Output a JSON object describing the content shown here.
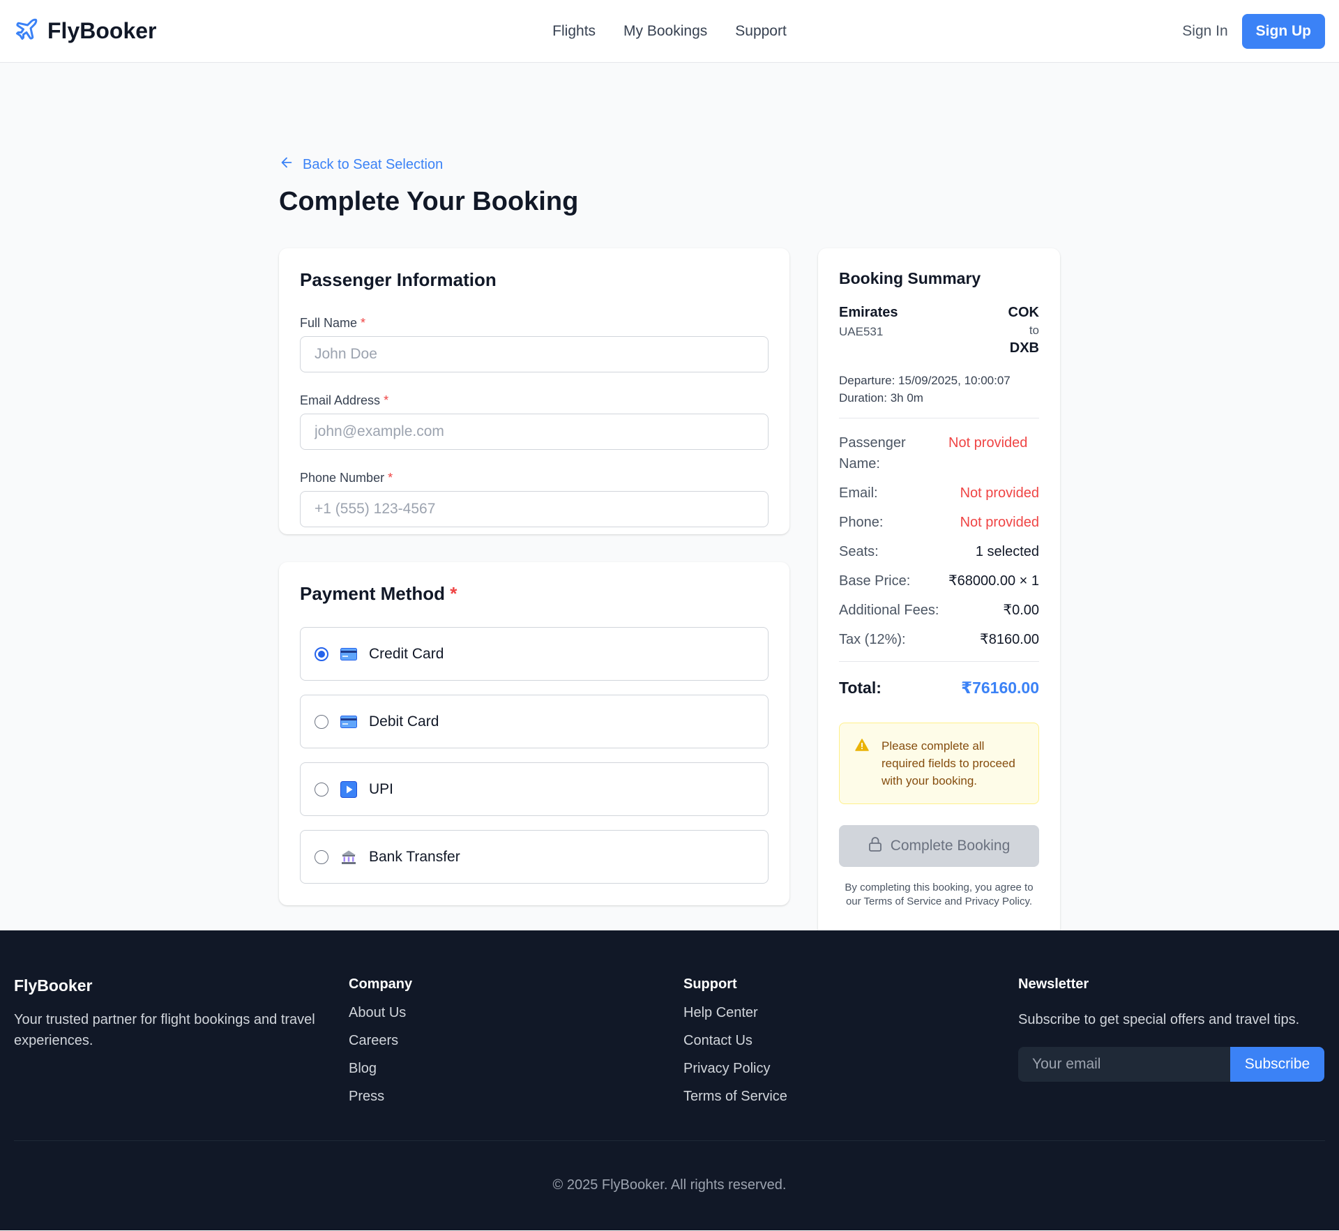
{
  "header": {
    "brand": "FlyBooker",
    "nav": [
      "Flights",
      "My Bookings",
      "Support"
    ],
    "sign_in": "Sign In",
    "sign_up": "Sign Up"
  },
  "page": {
    "back_link": "Back to Seat Selection",
    "title": "Complete Your Booking"
  },
  "passenger": {
    "title": "Passenger Information",
    "fields": [
      {
        "label": "Full Name",
        "required": "*",
        "placeholder": "John Doe",
        "value": ""
      },
      {
        "label": "Email Address",
        "required": "*",
        "placeholder": "john@example.com",
        "value": ""
      },
      {
        "label": "Phone Number",
        "required": "*",
        "placeholder": "+1 (555) 123-4567",
        "value": ""
      }
    ]
  },
  "payment": {
    "title": "Payment Method",
    "required": "*",
    "options": [
      {
        "label": "Credit Card",
        "icon": "credit-card-icon",
        "selected": true
      },
      {
        "label": "Debit Card",
        "icon": "credit-card-icon",
        "selected": false
      },
      {
        "label": "UPI",
        "icon": "play-icon",
        "selected": false
      },
      {
        "label": "Bank Transfer",
        "icon": "bank-icon",
        "selected": false
      }
    ]
  },
  "summary": {
    "title": "Booking Summary",
    "airline": "Emirates",
    "flight_no": "UAE531",
    "from": "COK",
    "to_word": "to",
    "to": "DXB",
    "departure": "Departure: 15/09/2025, 10:00:07",
    "duration": "Duration: 3h 0m",
    "rows": [
      {
        "key": "Passenger Name:",
        "value": "Not provided",
        "missing": true
      },
      {
        "key": "Email:",
        "value": "Not provided",
        "missing": true
      },
      {
        "key": "Phone:",
        "value": "Not provided",
        "missing": true
      },
      {
        "key": "Seats:",
        "value": "1 selected",
        "missing": false
      },
      {
        "key": "Base Price:",
        "value": "₹68000.00 × 1",
        "missing": false
      },
      {
        "key": "Additional Fees:",
        "value": "₹0.00",
        "missing": false
      },
      {
        "key": "Tax (12%):",
        "value": "₹8160.00",
        "missing": false
      }
    ],
    "total_label": "Total:",
    "total_value": "₹76160.00",
    "warning": "Please complete all required fields to proceed with your booking.",
    "cta": "Complete Booking",
    "terms": "By completing this booking, you agree to our Terms of Service and Privacy Policy."
  },
  "footer": {
    "brand": "FlyBooker",
    "tagline": "Your trusted partner for flight bookings and travel experiences.",
    "company_title": "Company",
    "company_links": [
      "About Us",
      "Careers",
      "Blog",
      "Press"
    ],
    "support_title": "Support",
    "support_links": [
      "Help Center",
      "Contact Us",
      "Privacy Policy",
      "Terms of Service"
    ],
    "newsletter_title": "Newsletter",
    "newsletter_text": "Subscribe to get special offers and travel tips.",
    "email_placeholder": "Your email",
    "subscribe": "Subscribe",
    "copyright": "© 2025 FlyBooker. All rights reserved."
  },
  "colors": {
    "accent": "#3b82f6",
    "error": "#ef4444",
    "warning_bg": "#fefce8",
    "warning_text": "#854d0e",
    "footer_bg": "#111827"
  }
}
